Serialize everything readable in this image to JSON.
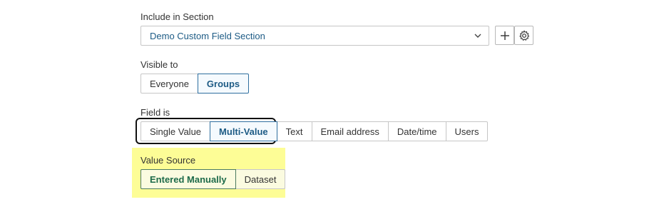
{
  "include_section": {
    "label": "Include in Section",
    "selected": "Demo Custom Field Section",
    "add_icon": "plus-icon",
    "settings_icon": "gear-icon"
  },
  "visible_to": {
    "label": "Visible to",
    "options": [
      "Everyone",
      "Groups"
    ],
    "selected": "Groups"
  },
  "field_is": {
    "label": "Field is",
    "options": [
      "Single Value",
      "Multi-Value",
      "Text",
      "Email address",
      "Date/time",
      "Users"
    ],
    "selected": "Multi-Value"
  },
  "value_source": {
    "label": "Value Source",
    "options": [
      "Entered Manually",
      "Dataset"
    ],
    "selected": "Entered Manually"
  },
  "colors": {
    "accent": "#1d5b85",
    "highlight": "#fdfd96",
    "focus_ring": "#111111"
  }
}
